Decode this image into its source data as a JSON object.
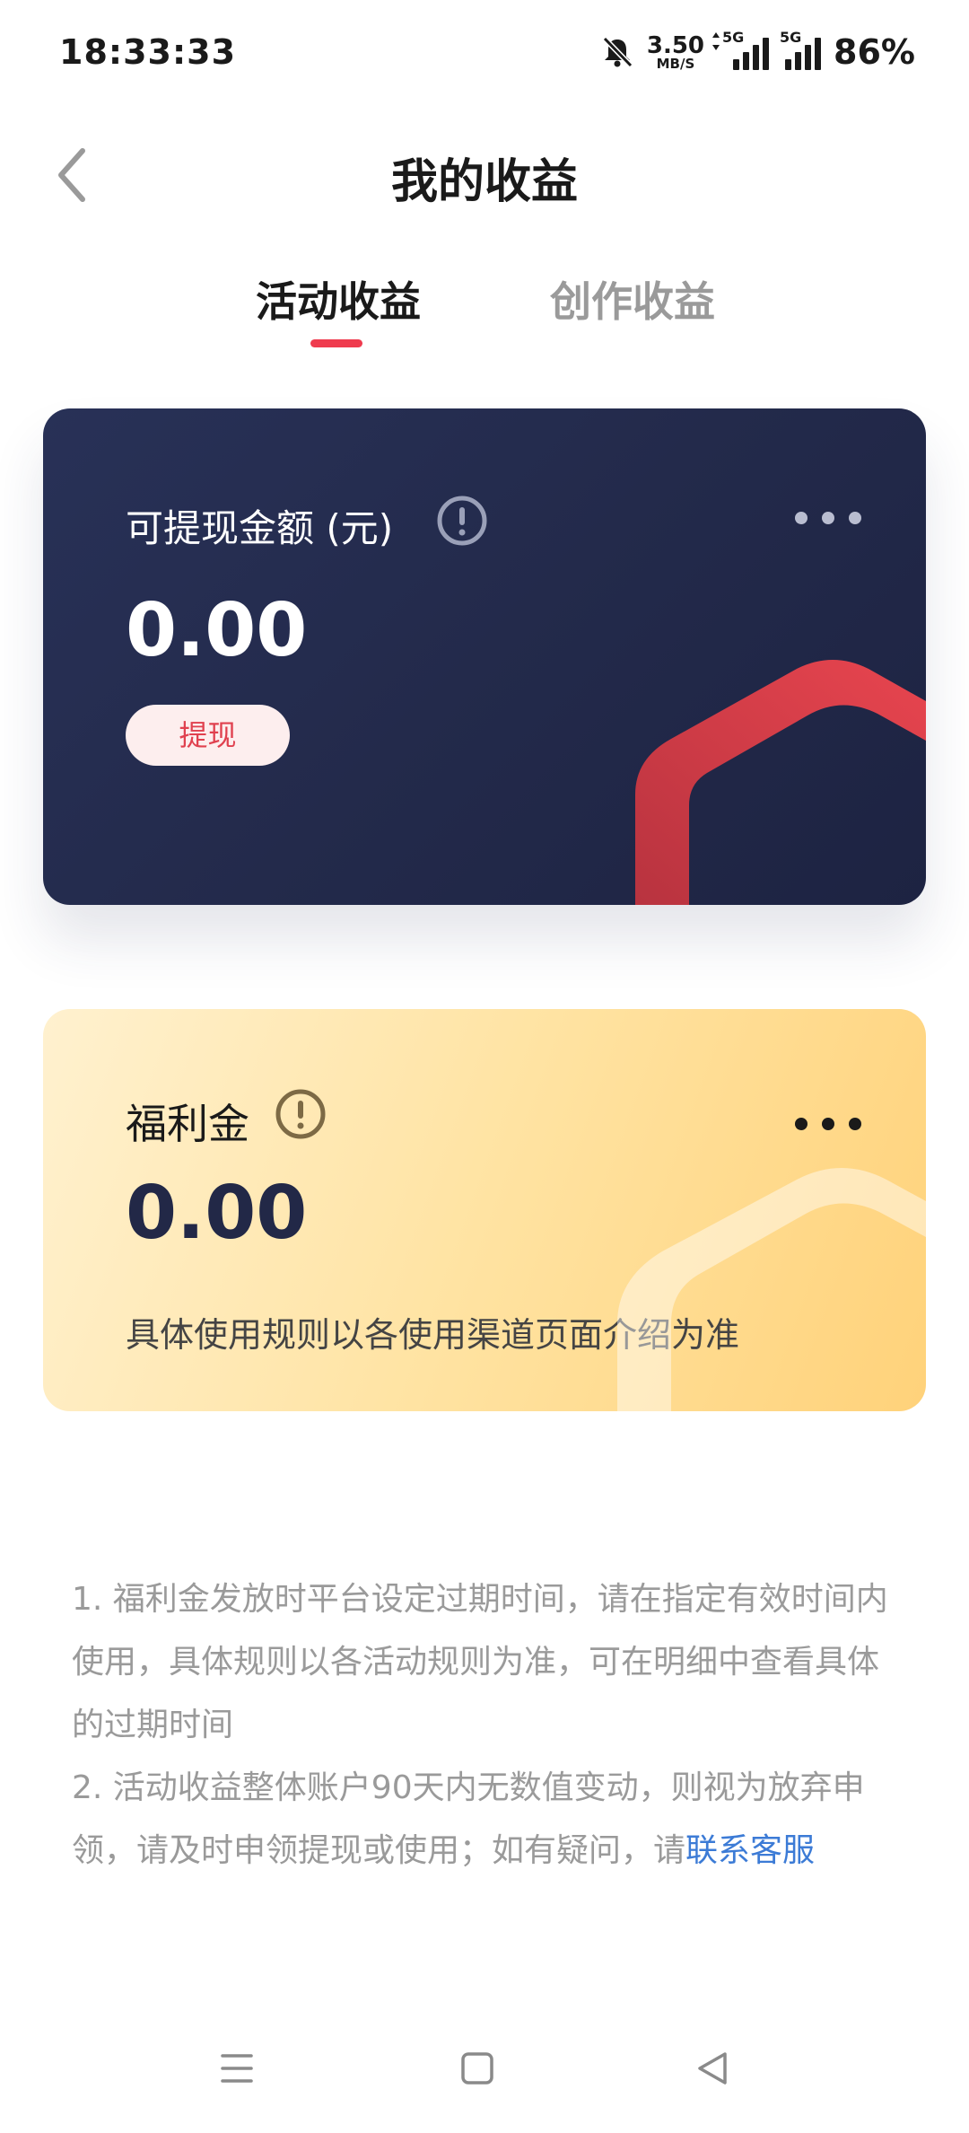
{
  "status_bar": {
    "time": "18:33:33",
    "net_speed_value": "3.50",
    "net_speed_unit": "MB/S",
    "network_1": "5G",
    "network_2": "5G",
    "battery": "86%",
    "icons": [
      "bell-muted-icon",
      "data-arrows-icon",
      "signal-icon",
      "signal-icon"
    ]
  },
  "header": {
    "title": "我的收益",
    "back_icon": "chevron-left-icon"
  },
  "tabs": [
    {
      "label": "活动收益",
      "active": true
    },
    {
      "label": "创作收益",
      "active": false
    }
  ],
  "withdrawable_card": {
    "label": "可提现金额 (元)",
    "amount": "0.00",
    "button_label": "提现",
    "info_icon": "info-icon",
    "more_icon": "more-dots-icon",
    "accent_color": "#e0414f"
  },
  "welfare_card": {
    "label": "福利金",
    "amount": "0.00",
    "note": "具体使用规则以各使用渠道页面介绍为准",
    "info_icon": "info-icon",
    "more_icon": "more-dots-icon"
  },
  "notes": {
    "item1": "1. 福利金发放时平台设定过期时间，请在指定有效时间内使用，具体规则以各活动规则为准，可在明细中查看具体的过期时间",
    "item2_text": "2. 活动收益整体账户90天内无数值变动，则视为放弃申领，请及时申领提现或使用；如有疑问，请",
    "item2_link": "联系客服"
  },
  "nav_bar": {
    "icons": [
      "menu-icon",
      "home-square-icon",
      "back-triangle-icon"
    ]
  }
}
